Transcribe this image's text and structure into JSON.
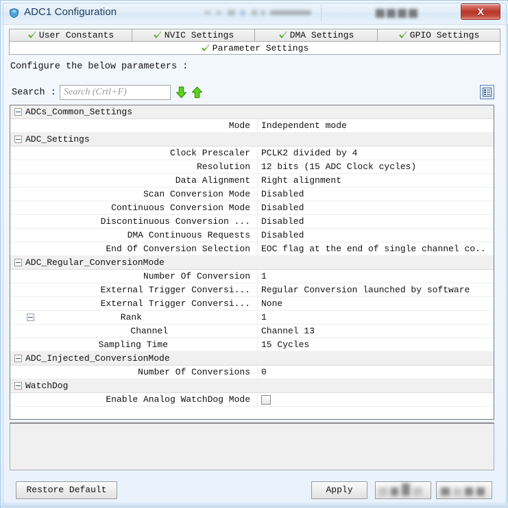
{
  "window": {
    "title": "ADC1 Configuration",
    "app_icon": "shield-icon",
    "close_label": "X"
  },
  "tabs": [
    {
      "label": "User Constants",
      "icon": "green-check-icon",
      "active": false
    },
    {
      "label": "NVIC Settings",
      "icon": "green-check-icon",
      "active": false
    },
    {
      "label": "DMA Settings",
      "icon": "green-check-icon",
      "active": false
    },
    {
      "label": "GPIO Settings",
      "icon": "green-check-icon",
      "active": false
    }
  ],
  "active_tab": {
    "label": "Parameter Settings",
    "icon": "green-check-icon"
  },
  "body": {
    "instruction": "Configure the below parameters :",
    "search_label": "Search :",
    "search_value": "",
    "search_placeholder": "Search (Crtl+F)",
    "search_next_icon": "green-down-arrow-icon",
    "search_prev_icon": "green-up-arrow-icon",
    "list_view_icon": "list-view-icon"
  },
  "parameters": [
    {
      "type": "group",
      "name": "ADCs_Common_Settings",
      "value": "",
      "expanded": true
    },
    {
      "type": "item",
      "name": "Mode",
      "value": "Independent mode"
    },
    {
      "type": "group",
      "name": "ADC_Settings",
      "value": "",
      "expanded": true
    },
    {
      "type": "item",
      "name": "Clock Prescaler",
      "value": "PCLK2 divided by 4"
    },
    {
      "type": "item",
      "name": "Resolution",
      "value": "12 bits (15 ADC Clock cycles)"
    },
    {
      "type": "item",
      "name": "Data Alignment",
      "value": "Right alignment"
    },
    {
      "type": "item",
      "name": "Scan Conversion Mode",
      "value": "Disabled"
    },
    {
      "type": "item",
      "name": "Continuous Conversion Mode",
      "value": "Disabled"
    },
    {
      "type": "item",
      "name": "Discontinuous Conversion ...",
      "value": "Disabled"
    },
    {
      "type": "item",
      "name": "DMA Continuous Requests",
      "value": "Disabled"
    },
    {
      "type": "item",
      "name": "End Of Conversion Selection",
      "value": "EOC flag at the end of single channel co..."
    },
    {
      "type": "group",
      "name": "ADC_Regular_ConversionMode",
      "value": "",
      "expanded": true
    },
    {
      "type": "item",
      "name": "Number Of Conversion",
      "value": "1"
    },
    {
      "type": "item",
      "name": "External Trigger Conversi...",
      "value": "Regular Conversion launched by software"
    },
    {
      "type": "item",
      "name": "External Trigger Conversi...",
      "value": "None"
    },
    {
      "type": "subgroup",
      "name": "Rank",
      "value": "1",
      "expanded": true
    },
    {
      "type": "subitem",
      "name": "Channel",
      "value": "Channel 13"
    },
    {
      "type": "subitem",
      "name": "Sampling Time",
      "value": "15 Cycles"
    },
    {
      "type": "group",
      "name": "ADC_Injected_ConversionMode",
      "value": "",
      "expanded": true
    },
    {
      "type": "item",
      "name": "Number Of Conversions",
      "value": "0"
    },
    {
      "type": "group",
      "name": "WatchDog",
      "value": "",
      "expanded": true
    },
    {
      "type": "checkbox",
      "name": "Enable Analog WatchDog Mode",
      "value": "",
      "checked": false
    }
  ],
  "footer": {
    "restore_label": "Restore Default",
    "apply_label": "Apply",
    "ok_label": "",
    "cancel_label": ""
  },
  "colors": {
    "accent": "#5b84b1",
    "check_green": "#6cbf3f",
    "arrow_green": "#4fbe1f",
    "close_red": "#b8352a",
    "group_bg": "#f0f0f0"
  }
}
